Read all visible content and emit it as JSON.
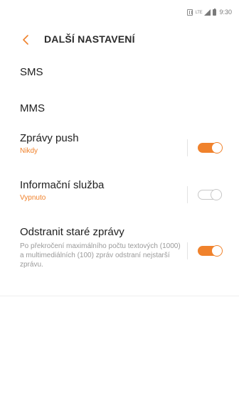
{
  "status_bar": {
    "lte_label": "LTE",
    "time": "9:30",
    "icons": [
      "nfc-icon",
      "lte-icon",
      "signal-icon",
      "battery-icon"
    ]
  },
  "header": {
    "back_icon": "chevron-left-icon",
    "title": "DALŠÍ NASTAVENÍ"
  },
  "colors": {
    "accent": "#f0822c",
    "text": "#1e1e1e",
    "secondary_text": "#9a9a9a",
    "switch_off": "#c8c8c8"
  },
  "items": [
    {
      "title": "SMS"
    },
    {
      "title": "MMS"
    },
    {
      "title": "Zprávy push",
      "subtitle": "Nikdy",
      "toggle": true
    },
    {
      "title": "Informační služba",
      "subtitle": "Vypnuto",
      "toggle": false
    },
    {
      "title": "Odstranit staré zprávy",
      "description": "Po překročení maximálního počtu textových (1000) a multimediálních (100) zpráv odstraní nejstarší zprávu.",
      "toggle": true
    }
  ]
}
